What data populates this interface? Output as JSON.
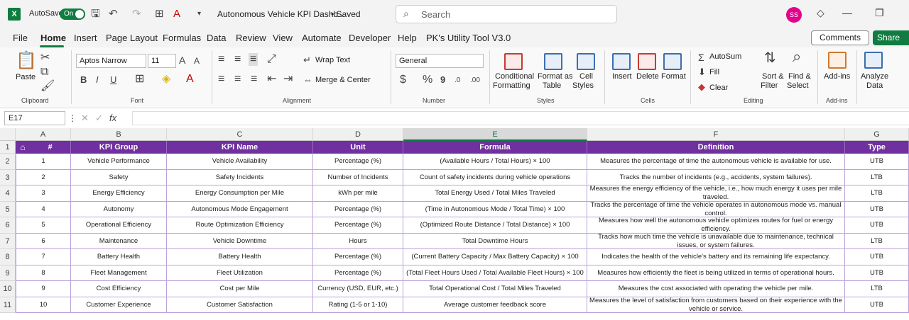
{
  "titlebar": {
    "autosave_label": "AutoSave",
    "toggle_label": "On",
    "doc_title": "Autonomous Vehicle KPI Dashb...",
    "saved_label": "• Saved",
    "search_placeholder": "Search",
    "avatar_initials": "SS"
  },
  "menu": {
    "items": [
      "File",
      "Home",
      "Insert",
      "Page Layout",
      "Formulas",
      "Data",
      "Review",
      "View",
      "Automate",
      "Developer",
      "Help",
      "PK's Utility Tool V3.0"
    ],
    "active": "Home",
    "comments_label": "Comments",
    "share_label": "Share"
  },
  "ribbon": {
    "clipboard": {
      "paste": "Paste",
      "group": "Clipboard"
    },
    "font": {
      "name": "Aptos Narrow",
      "size": "11",
      "group": "Font"
    },
    "alignment": {
      "wrap": "Wrap Text",
      "merge": "Merge & Center",
      "group": "Alignment"
    },
    "number": {
      "format": "General",
      "group": "Number"
    },
    "styles": {
      "conditional": "Conditional",
      "conditional2": "Formatting",
      "format_as": "Format as",
      "format_as2": "Table",
      "cell": "Cell",
      "cell2": "Styles",
      "group": "Styles"
    },
    "cells": {
      "insert": "Insert",
      "delete": "Delete",
      "format": "Format",
      "group": "Cells"
    },
    "editing": {
      "autosum": "AutoSum",
      "fill": "Fill",
      "clear": "Clear",
      "sort": "Sort &",
      "sort2": "Filter",
      "find": "Find &",
      "find2": "Select",
      "group": "Editing"
    },
    "addins": {
      "label": "Add-ins",
      "group": "Add-ins"
    },
    "analyze": {
      "label": "Analyze",
      "label2": "Data"
    }
  },
  "formula_bar": {
    "name_box": "E17",
    "fx": "fx",
    "content": ""
  },
  "sheet": {
    "columns": [
      "A",
      "B",
      "C",
      "D",
      "E",
      "F",
      "G"
    ],
    "selected_column": "E",
    "headers": [
      "#",
      "KPI Group",
      "KPI Name",
      "Unit",
      "Formula",
      "Definition",
      "Type"
    ],
    "rows": [
      [
        "1",
        "Vehicle Performance",
        "Vehicle Availability",
        "Percentage (%)",
        "(Available Hours / Total Hours) × 100",
        "Measures the percentage of time the autonomous vehicle is available for use.",
        "UTB"
      ],
      [
        "2",
        "Safety",
        "Safety Incidents",
        "Number of Incidents",
        "Count of safety incidents during vehicle operations",
        "Tracks the number of incidents (e.g., accidents, system failures).",
        "LTB"
      ],
      [
        "3",
        "Energy Efficiency",
        "Energy Consumption per Mile",
        "kWh per mile",
        "Total Energy Used / Total Miles Traveled",
        "Measures the energy efficiency of the vehicle, i.e., how much energy it uses per mile traveled.",
        "LTB"
      ],
      [
        "4",
        "Autonomy",
        "Autonomous Mode Engagement",
        "Percentage (%)",
        "(Time in Autonomous Mode / Total Time) × 100",
        "Tracks the percentage of time the vehicle operates in autonomous mode vs. manual control.",
        "UTB"
      ],
      [
        "5",
        "Operational Efficiency",
        "Route Optimization Efficiency",
        "Percentage (%)",
        "(Optimized Route Distance / Total Distance) × 100",
        "Measures how well the autonomous vehicle optimizes routes for fuel or energy efficiency.",
        "UTB"
      ],
      [
        "6",
        "Maintenance",
        "Vehicle Downtime",
        "Hours",
        "Total Downtime Hours",
        "Tracks how much time the vehicle is unavailable due to maintenance, technical issues, or system failures.",
        "LTB"
      ],
      [
        "7",
        "Battery Health",
        "Battery Health",
        "Percentage (%)",
        "(Current Battery Capacity / Max Battery Capacity) × 100",
        "Indicates the health of the vehicle's battery and its remaining life expectancy.",
        "UTB"
      ],
      [
        "8",
        "Fleet Management",
        "Fleet Utilization",
        "Percentage (%)",
        "(Total Fleet Hours Used / Total Available Fleet Hours) × 100",
        "Measures how efficiently the fleet is being utilized in terms of operational hours.",
        "UTB"
      ],
      [
        "9",
        "Cost Efficiency",
        "Cost per Mile",
        "Currency (USD, EUR, etc.)",
        "Total Operational Cost / Total Miles Traveled",
        "Measures the cost associated with operating the vehicle per mile.",
        "LTB"
      ],
      [
        "10",
        "Customer Experience",
        "Customer Satisfaction",
        "Rating (1-5 or 1-10)",
        "Average customer feedback score",
        "Measures the level of satisfaction from customers based on their experience with the vehicle or service.",
        "UTB"
      ]
    ],
    "row_numbers": [
      "1",
      "2",
      "3",
      "4",
      "5",
      "6",
      "7",
      "8",
      "9",
      "10",
      "11"
    ]
  }
}
